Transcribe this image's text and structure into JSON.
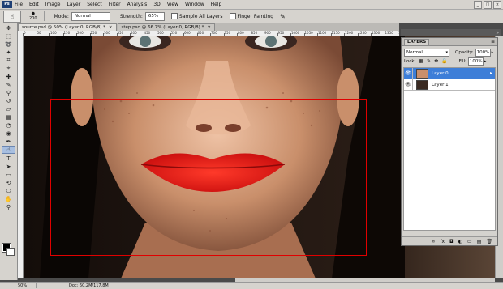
{
  "menu": {
    "logo": "Ps",
    "items": [
      "File",
      "Edit",
      "Image",
      "Layer",
      "Select",
      "Filter",
      "Analysis",
      "3D",
      "View",
      "Window",
      "Help"
    ]
  },
  "window_buttons": [
    "_",
    "□",
    "×"
  ],
  "options": {
    "brush_size": "200",
    "mode_label": "Mode:",
    "mode_value": "Normal",
    "strength_label": "Strength:",
    "strength_value": "65%",
    "sample_all_label": "Sample All Layers",
    "finger_painting_label": "Finger Painting"
  },
  "tabs": [
    {
      "label": "source.psd @ 50% (Layer 0, RGB/8) *",
      "close": "×"
    },
    {
      "label": "step.psd @ 66.7% (Layer 0, RGB/8) *",
      "close": "×"
    }
  ],
  "ruler_ticks": [
    "0",
    "50",
    "100",
    "150",
    "200",
    "250",
    "300",
    "350",
    "400",
    "450",
    "500",
    "550",
    "600",
    "650",
    "700",
    "750",
    "800",
    "850",
    "900",
    "950",
    "1000",
    "1050",
    "1100",
    "1150",
    "1200",
    "1250",
    "1300",
    "1350",
    "1400"
  ],
  "layers_panel": {
    "title": "LAYERS",
    "blend_mode": "Normal",
    "opacity_label": "Opacity:",
    "opacity_value": "100%",
    "lock_label": "Lock:",
    "fill_label": "Fill:",
    "fill_value": "100%",
    "layers": [
      {
        "name": "Layer 0",
        "active": true
      },
      {
        "name": "Layer 1",
        "active": false
      }
    ],
    "bottom_icons": [
      "∞",
      "fx",
      "◘",
      "◐",
      "▭",
      "▤",
      "🗑"
    ]
  },
  "status": {
    "zoom": "50%",
    "doc": "Doc: 60.2M/117.8M"
  },
  "colors": {
    "selection": "#e00000",
    "lips": "#e31414",
    "active_layer": "#3d7ed8",
    "chrome": "#d6d3ce"
  }
}
